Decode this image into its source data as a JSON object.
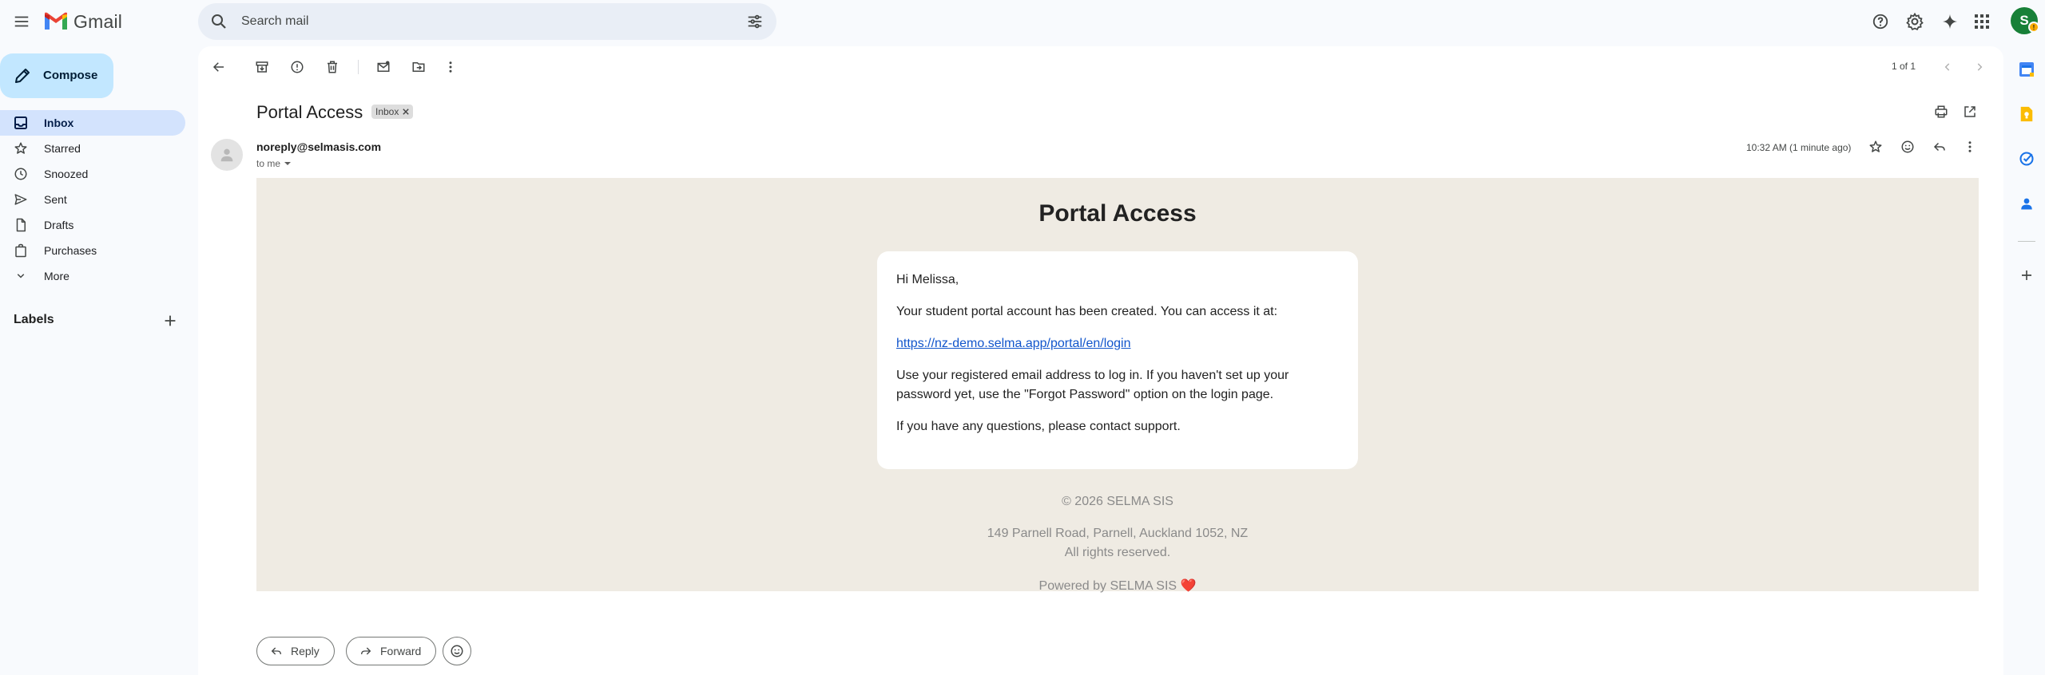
{
  "app": {
    "name": "Gmail"
  },
  "search": {
    "placeholder": "Search mail"
  },
  "sidebar": {
    "compose_label": "Compose",
    "items": [
      {
        "label": "Inbox",
        "icon": "inbox-icon",
        "active": true
      },
      {
        "label": "Starred",
        "icon": "star-icon"
      },
      {
        "label": "Snoozed",
        "icon": "clock-icon"
      },
      {
        "label": "Sent",
        "icon": "send-icon"
      },
      {
        "label": "Drafts",
        "icon": "draft-icon"
      },
      {
        "label": "Purchases",
        "icon": "shopping-bag-icon"
      },
      {
        "label": "More",
        "icon": "chevron-down-icon"
      }
    ],
    "labels_title": "Labels"
  },
  "account": {
    "initial": "S",
    "badge": "!"
  },
  "toolbar": {
    "pager": "1 of 1"
  },
  "message": {
    "subject": "Portal Access",
    "label_chip": "Inbox",
    "sender": "noreply@selmasis.com",
    "recipient": "to me",
    "time": "10:32 AM (1 minute ago)"
  },
  "email_body": {
    "title": "Portal Access",
    "greeting": "Hi Melissa,",
    "paragraph1": "Your student portal account has been created. You can access it at:",
    "link": "https://nz-demo.selma.app/portal/en/login",
    "paragraph2": "Use your registered email address to log in. If you haven't set up your password yet, use the \"Forgot Password\" option on the login page.",
    "paragraph3": "If you have any questions, please contact support.",
    "footer_copyright": "© 2026 SELMA SIS",
    "footer_address": "149 Parnell Road, Parnell, Auckland 1052, NZ",
    "footer_rights": "All rights reserved.",
    "footer_powered": "Powered by SELMA SIS",
    "footer_heart": "❤️"
  },
  "actions": {
    "reply": "Reply",
    "forward": "Forward"
  },
  "colors": {
    "accent": "#c2e7ff",
    "active_nav": "#d3e3fd",
    "email_bg": "#efebe3",
    "link": "#1155cc"
  }
}
